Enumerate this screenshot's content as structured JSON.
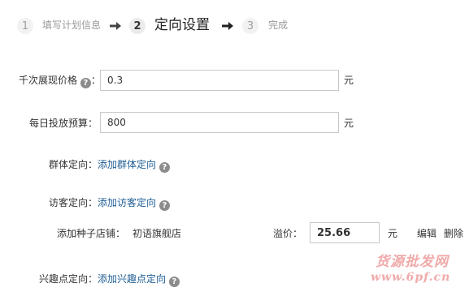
{
  "steps": [
    {
      "num": "1",
      "label": "填写计划信息"
    },
    {
      "num": "2",
      "label": "定向设置"
    },
    {
      "num": "3",
      "label": "完成"
    }
  ],
  "form": {
    "cpm_label": "千次展现价格",
    "cpm_colon": "：",
    "cpm_value": "0.3",
    "cpm_unit": "元",
    "budget_label": "每日投放预算：",
    "budget_value": "800",
    "budget_unit": "元",
    "crowd_label": "群体定向：",
    "crowd_link": "添加群体定向",
    "visitor_label": "访客定向：",
    "visitor_link": "添加访客定向",
    "seed_label": "添加种子店铺：",
    "seed_store": "初语旗舰店",
    "premium_label": "溢价：",
    "premium_value": "25.66",
    "premium_unit": "元",
    "edit_label": "编辑",
    "delete_label": "删除",
    "interest_label": "兴趣点定向：",
    "interest_link": "添加兴趣点定向"
  },
  "help_glyph": "?",
  "watermark": {
    "line1": "货源批发网",
    "line2": "www.6pf.cn"
  },
  "icons": {
    "help": "help-circle-icon",
    "arrow": "arrow-right-icon"
  }
}
